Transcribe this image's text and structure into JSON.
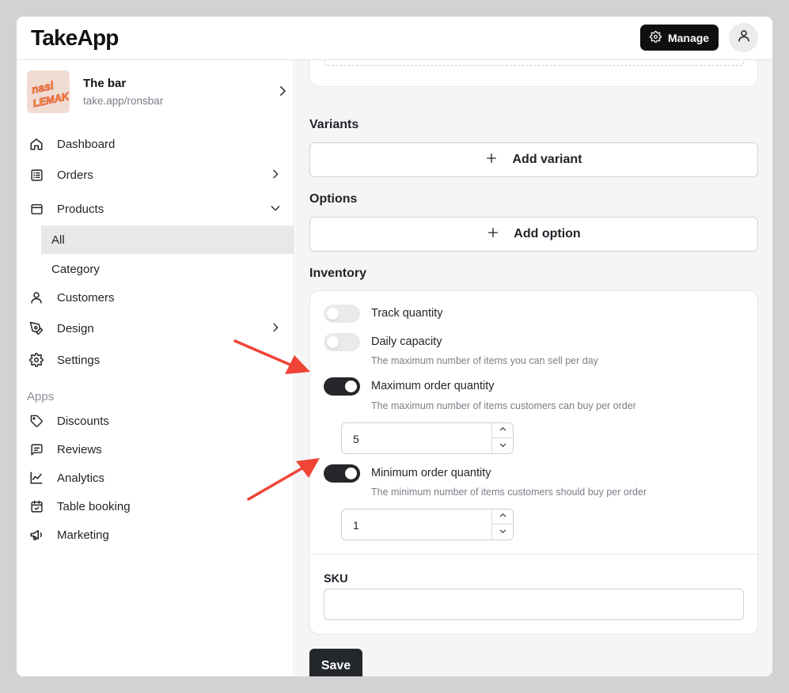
{
  "app": {
    "logo": "TakeApp"
  },
  "header": {
    "manage_label": "Manage"
  },
  "store": {
    "name": "The bar",
    "url": "take.app/ronsbar",
    "thumb_text": "nasi LEMAK"
  },
  "sidebar": {
    "items": [
      {
        "label": "Dashboard"
      },
      {
        "label": "Orders"
      },
      {
        "label": "Products"
      },
      {
        "label": "All"
      },
      {
        "label": "Category"
      },
      {
        "label": "Customers"
      },
      {
        "label": "Design"
      },
      {
        "label": "Settings"
      }
    ],
    "apps_label": "Apps",
    "apps": [
      {
        "label": "Discounts"
      },
      {
        "label": "Reviews"
      },
      {
        "label": "Analytics"
      },
      {
        "label": "Table booking"
      },
      {
        "label": "Marketing"
      }
    ]
  },
  "main": {
    "variants_heading": "Variants",
    "add_variant_label": "Add variant",
    "options_heading": "Options",
    "add_option_label": "Add option",
    "inventory_heading": "Inventory",
    "inventory": {
      "track_quantity": {
        "label": "Track quantity",
        "enabled": false
      },
      "daily_capacity": {
        "label": "Daily capacity",
        "enabled": false,
        "description": "The maximum number of items you can sell per day"
      },
      "max_order": {
        "label": "Maximum order quantity",
        "enabled": true,
        "description": "The maximum number of items customers can buy per order",
        "value": "5"
      },
      "min_order": {
        "label": "Minimum order quantity",
        "enabled": true,
        "description": "The minimum number of items customers should buy per order",
        "value": "1"
      }
    },
    "sku_label": "SKU",
    "sku_value": "",
    "save_label": "Save"
  },
  "colors": {
    "accent": "#26272b",
    "annotation_arrow": "#ef4436",
    "page_bg": "#d2d2d2"
  }
}
